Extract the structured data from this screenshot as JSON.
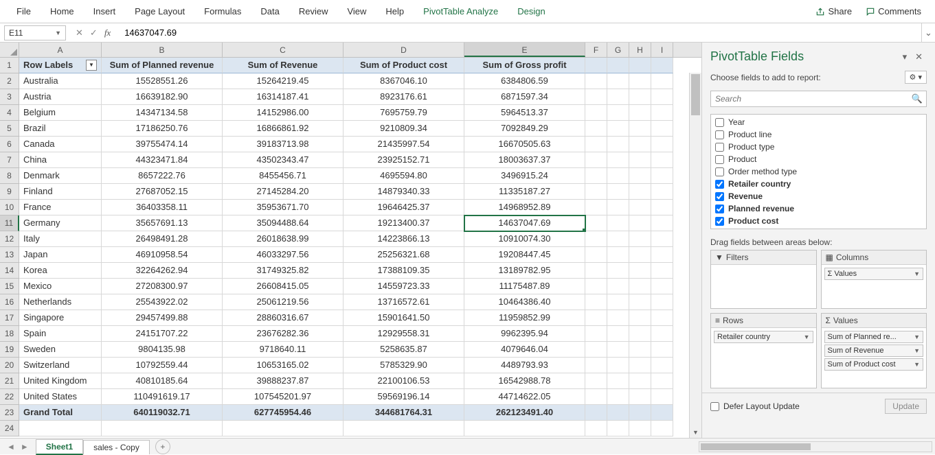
{
  "ribbon": {
    "menus": [
      "File",
      "Home",
      "Insert",
      "Page Layout",
      "Formulas",
      "Data",
      "Review",
      "View",
      "Help",
      "PivotTable Analyze",
      "Design"
    ],
    "share": "Share",
    "comments": "Comments"
  },
  "nameBox": "E11",
  "formula": "14637047.69",
  "columns": [
    "A",
    "B",
    "C",
    "D",
    "E",
    "F",
    "G",
    "H",
    "I"
  ],
  "headers": {
    "A": "Row Labels",
    "B": "Sum of Planned revenue",
    "C": "Sum of Revenue",
    "D": "Sum of Product cost",
    "E": "Sum of Gross profit"
  },
  "rows": [
    {
      "n": 2,
      "A": "Australia",
      "B": "15528551.26",
      "C": "15264219.45",
      "D": "8367046.10",
      "E": "6384806.59"
    },
    {
      "n": 3,
      "A": "Austria",
      "B": "16639182.90",
      "C": "16314187.41",
      "D": "8923176.61",
      "E": "6871597.34"
    },
    {
      "n": 4,
      "A": "Belgium",
      "B": "14347134.58",
      "C": "14152986.00",
      "D": "7695759.79",
      "E": "5964513.37"
    },
    {
      "n": 5,
      "A": "Brazil",
      "B": "17186250.76",
      "C": "16866861.92",
      "D": "9210809.34",
      "E": "7092849.29"
    },
    {
      "n": 6,
      "A": "Canada",
      "B": "39755474.14",
      "C": "39183713.98",
      "D": "21435997.54",
      "E": "16670505.63"
    },
    {
      "n": 7,
      "A": "China",
      "B": "44323471.84",
      "C": "43502343.47",
      "D": "23925152.71",
      "E": "18003637.37"
    },
    {
      "n": 8,
      "A": "Denmark",
      "B": "8657222.76",
      "C": "8455456.71",
      "D": "4695594.80",
      "E": "3496915.24"
    },
    {
      "n": 9,
      "A": "Finland",
      "B": "27687052.15",
      "C": "27145284.20",
      "D": "14879340.33",
      "E": "11335187.27"
    },
    {
      "n": 10,
      "A": "France",
      "B": "36403358.11",
      "C": "35953671.70",
      "D": "19646425.37",
      "E": "14968952.89"
    },
    {
      "n": 11,
      "A": "Germany",
      "B": "35657691.13",
      "C": "35094488.64",
      "D": "19213400.37",
      "E": "14637047.69"
    },
    {
      "n": 12,
      "A": "Italy",
      "B": "26498491.28",
      "C": "26018638.99",
      "D": "14223866.13",
      "E": "10910074.30"
    },
    {
      "n": 13,
      "A": "Japan",
      "B": "46910958.54",
      "C": "46033297.56",
      "D": "25256321.68",
      "E": "19208447.45"
    },
    {
      "n": 14,
      "A": "Korea",
      "B": "32264262.94",
      "C": "31749325.82",
      "D": "17388109.35",
      "E": "13189782.95"
    },
    {
      "n": 15,
      "A": "Mexico",
      "B": "27208300.97",
      "C": "26608415.05",
      "D": "14559723.33",
      "E": "11175487.89"
    },
    {
      "n": 16,
      "A": "Netherlands",
      "B": "25543922.02",
      "C": "25061219.56",
      "D": "13716572.61",
      "E": "10464386.40"
    },
    {
      "n": 17,
      "A": "Singapore",
      "B": "29457499.88",
      "C": "28860316.67",
      "D": "15901641.50",
      "E": "11959852.99"
    },
    {
      "n": 18,
      "A": "Spain",
      "B": "24151707.22",
      "C": "23676282.36",
      "D": "12929558.31",
      "E": "9962395.94"
    },
    {
      "n": 19,
      "A": "Sweden",
      "B": "9804135.98",
      "C": "9718640.11",
      "D": "5258635.87",
      "E": "4079646.04"
    },
    {
      "n": 20,
      "A": "Switzerland",
      "B": "10792559.44",
      "C": "10653165.02",
      "D": "5785329.90",
      "E": "4489793.93"
    },
    {
      "n": 21,
      "A": "United Kingdom",
      "B": "40810185.64",
      "C": "39888237.87",
      "D": "22100106.53",
      "E": "16542988.78"
    },
    {
      "n": 22,
      "A": "United States",
      "B": "110491619.17",
      "C": "107545201.97",
      "D": "59569196.14",
      "E": "44714622.05"
    }
  ],
  "grandTotal": {
    "A": "Grand Total",
    "B": "640119032.71",
    "C": "627745954.46",
    "D": "344681764.31",
    "E": "262123491.40"
  },
  "selectedCell": {
    "row": 11,
    "col": "E"
  },
  "fieldsPane": {
    "title": "PivotTable Fields",
    "subtitle": "Choose fields to add to report:",
    "searchPlaceholder": "Search",
    "fields": [
      {
        "name": "Year",
        "checked": false
      },
      {
        "name": "Product line",
        "checked": false
      },
      {
        "name": "Product type",
        "checked": false
      },
      {
        "name": "Product",
        "checked": false
      },
      {
        "name": "Order method type",
        "checked": false
      },
      {
        "name": "Retailer country",
        "checked": true
      },
      {
        "name": "Revenue",
        "checked": true
      },
      {
        "name": "Planned revenue",
        "checked": true
      },
      {
        "name": "Product cost",
        "checked": true
      }
    ],
    "dragLabel": "Drag fields between areas below:",
    "areas": {
      "filters": {
        "title": "Filters",
        "items": []
      },
      "columns": {
        "title": "Columns",
        "items": [
          "Σ Values"
        ]
      },
      "rows": {
        "title": "Rows",
        "items": [
          "Retailer country"
        ]
      },
      "values": {
        "title": "Values",
        "items": [
          "Sum of Planned re...",
          "Sum of Revenue",
          "Sum of Product cost"
        ]
      }
    },
    "deferLabel": "Defer Layout Update",
    "updateBtn": "Update"
  },
  "sheets": {
    "active": "Sheet1",
    "other": "sales - Copy"
  }
}
